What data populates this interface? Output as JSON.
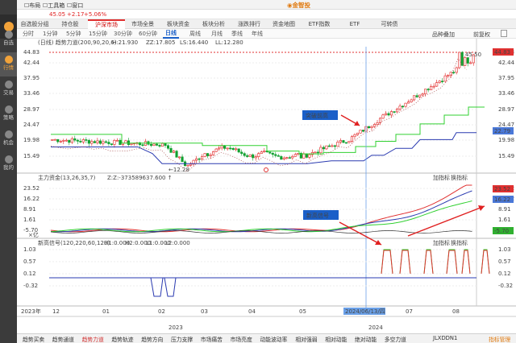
{
  "sidebar": {
    "items": [
      {
        "label": "自选",
        "icon": "star-icon"
      },
      {
        "label": "行情",
        "icon": "chart-icon",
        "active": true
      },
      {
        "label": "交易",
        "icon": "trade-icon"
      },
      {
        "label": "策略",
        "icon": "strategy-icon"
      },
      {
        "label": "机会",
        "icon": "opportunity-icon"
      },
      {
        "label": "我的",
        "icon": "user-icon"
      }
    ]
  },
  "menubar": {
    "items": [
      "布局",
      "工具箱",
      "窗口"
    ],
    "brand": "金智投"
  },
  "pricebar": {
    "price": "45.05",
    "change": "+2.17",
    "pct": "+5.06%"
  },
  "tabs1": [
    "自选股分组",
    "持仓股",
    "沪深市场",
    "市场全景",
    "板块资金",
    "板块分析",
    "涨跌排行",
    "资金地图",
    "ETF指数",
    "ETF",
    "可转债"
  ],
  "tabs1_active": 2,
  "tabs2": [
    "分时",
    "1分钟",
    "5分钟",
    "15分钟",
    "30分钟",
    "60分钟",
    "日线",
    "周线",
    "月线",
    "季线",
    "年线"
  ],
  "tabs2_active": 6,
  "toolbar_right": {
    "stock_switch": "品种叠加",
    "adjust": "前复权"
  },
  "main_panel": {
    "header_prefix": "(日线) 趋势力道(200,90,20,6)",
    "h_label": "H:21.930",
    "zz_label": "ZZ:17.805",
    "ls_label": "LS:16.440",
    "ll_label": "LL:12.280",
    "y_ticks": [
      "44.83",
      "42.44",
      "37.95",
      "33.46",
      "28.97",
      "24.47",
      "19.98",
      "15.49"
    ],
    "right_badge_top": "44.83",
    "right_badge_mid": "22.79",
    "high_label": "45.50",
    "low_label": "12.28",
    "annotation_breakout": "突破前高",
    "mark_label": "0"
  },
  "fund_panel": {
    "header": "主力资金(13,26,35,7)",
    "z_label": "Z:Z:-373589637.600 ↑",
    "y_ticks": [
      "23.52",
      "16.22",
      "8.91",
      "1.61",
      "-5.70"
    ],
    "right_badges": [
      "23.52",
      "16.22",
      "-5.70"
    ],
    "left_axis_label": "×亿",
    "tools": [
      "加指标",
      "换指标"
    ]
  },
  "signal_panel": {
    "header": "新高信号(120,220,60,120)",
    "h1": "H1:0.000",
    "h2": "H2:0.000",
    "l1": "L1:0.000",
    "l2": "L2:0.000",
    "y_ticks": [
      "1.03",
      "0.57",
      "0.12",
      "-0.32"
    ],
    "tools": [
      "加指标",
      "换指标"
    ],
    "annotation": "新高信号"
  },
  "x_axis": {
    "labels": [
      "2023年",
      "12",
      "01",
      "02",
      "03",
      "04",
      "05",
      "2024/06/13/四",
      "07",
      "08"
    ],
    "years": [
      "2023",
      "2024"
    ]
  },
  "colors": {
    "up": "#e02020",
    "down": "#10a030",
    "sidebar_bg": "#3b3b3b",
    "accent": "#f2a33a",
    "blue_line": "#2a3ab0",
    "green_line": "#30d030",
    "badge_red": "#e03030"
  },
  "bottombar": {
    "items": [
      "趋势买卖",
      "趋势通道",
      "趋势力道",
      "趋势轨迹",
      "趋势方向",
      "压力支撑",
      "市场痛苦",
      "市场亮度",
      "动能波动率",
      "相对强弱",
      "相对动能",
      "绝对动能",
      "多空力道"
    ],
    "active": 2,
    "stock_code": "JLXDDN1",
    "right_label": "指标管理"
  },
  "chart_data": {
    "type": "candlestick",
    "note_series": [
      "price",
      "support",
      "fund_flow",
      "signal"
    ],
    "y_range": [
      12.28,
      45.5
    ],
    "price_high": 45.5,
    "price_low": 12.28,
    "current_price": 44.83,
    "selected_date": "2024/06/13"
  }
}
